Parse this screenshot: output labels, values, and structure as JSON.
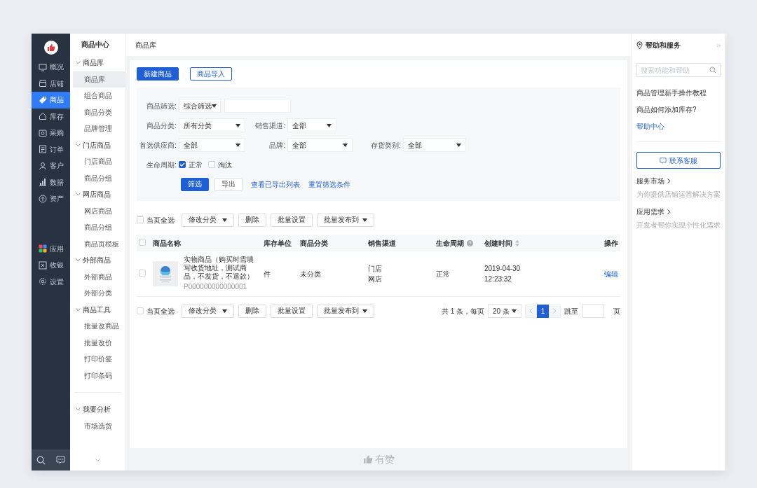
{
  "nav": {
    "main": [
      {
        "label": "概况",
        "kind": "monitor",
        "selected": false
      },
      {
        "label": "店铺",
        "kind": "shop",
        "selected": false
      },
      {
        "label": "商品",
        "kind": "tag",
        "selected": true
      },
      {
        "label": "库存",
        "kind": "house",
        "selected": false
      },
      {
        "label": "采购",
        "kind": "camera",
        "selected": false
      },
      {
        "label": "订单",
        "kind": "document",
        "selected": false
      },
      {
        "label": "客户",
        "kind": "person",
        "selected": false
      },
      {
        "label": "数据",
        "kind": "chart",
        "selected": false
      },
      {
        "label": "资产",
        "kind": "coin",
        "selected": false
      }
    ],
    "extra": [
      {
        "label": "应用",
        "kind": "apps",
        "selected": false
      },
      {
        "label": "收银",
        "kind": "cashier",
        "selected": false
      },
      {
        "label": "设置",
        "kind": "gear",
        "selected": false
      }
    ]
  },
  "submenu": {
    "title": "商品中心",
    "groups": [
      {
        "label": "商品库",
        "expanded": true,
        "children": [
          {
            "label": "商品库",
            "selected": true
          },
          {
            "label": "组合商品",
            "selected": false
          },
          {
            "label": "商品分类",
            "selected": false
          },
          {
            "label": "品牌管理",
            "selected": false
          }
        ]
      },
      {
        "label": "门店商品",
        "expanded": true,
        "children": [
          {
            "label": "门店商品",
            "selected": false
          },
          {
            "label": "商品分组",
            "selected": false
          }
        ]
      },
      {
        "label": "网店商品",
        "expanded": true,
        "children": [
          {
            "label": "网店商品",
            "selected": false
          },
          {
            "label": "商品分组",
            "selected": false
          },
          {
            "label": "商品页模板",
            "selected": false
          }
        ]
      },
      {
        "label": "外部商品",
        "expanded": true,
        "children": [
          {
            "label": "外部商品",
            "selected": false
          },
          {
            "label": "外部分类",
            "selected": false
          }
        ]
      },
      {
        "label": "商品工具",
        "expanded": true,
        "children": [
          {
            "label": "批量改商品",
            "selected": false
          },
          {
            "label": "批量改价",
            "selected": false
          },
          {
            "label": "打印价签",
            "selected": false
          },
          {
            "label": "打印条码",
            "selected": false
          }
        ]
      }
    ],
    "extra_groups": [
      {
        "label": "我要分析",
        "expanded": true,
        "children": [
          {
            "label": "市场选货",
            "selected": false
          }
        ]
      }
    ]
  },
  "breadcrumb": "商品库",
  "toolbar": [
    {
      "label": "新建商品",
      "kind": "primary"
    },
    {
      "label": "商品导入",
      "kind": "outline"
    }
  ],
  "filters": {
    "rows": [
      {
        "fields": [
          {
            "label": "商品筛选:",
            "kind": "select",
            "value": "综合筛选"
          },
          {
            "kind": "input"
          }
        ]
      },
      {
        "fields": [
          {
            "label": "商品分类:",
            "kind": "select",
            "value": "所有分类"
          },
          {
            "label": "销售渠道:",
            "kind": "select",
            "value": "全部"
          }
        ]
      },
      {
        "fields": [
          {
            "label": "首选供应商:",
            "kind": "select",
            "value": "全部"
          },
          {
            "label": "品牌:",
            "kind": "select",
            "value": "全部"
          },
          {
            "label": "存货类别:",
            "kind": "select",
            "value": "全部"
          }
        ]
      }
    ],
    "lifecycle": {
      "label": "生命周期:",
      "options": [
        {
          "label": "正常",
          "checked": true
        },
        {
          "label": "淘汰",
          "checked": false
        }
      ]
    },
    "actions": [
      {
        "label": "筛选",
        "kind": "primary"
      },
      {
        "label": "导出",
        "kind": "default"
      },
      {
        "label": "查看已导出列表",
        "kind": "link"
      },
      {
        "label": "重置筛选条件",
        "kind": "link"
      }
    ]
  },
  "bulk_top": {
    "select_all": {
      "label": "当页全选",
      "checked": false
    },
    "actions": [
      {
        "label": "修改分类",
        "kind": "dropdown"
      },
      {
        "label": "删除",
        "kind": "button"
      },
      {
        "label": "批量设置",
        "kind": "button"
      },
      {
        "label": "批量发布到",
        "kind": "dropdown"
      }
    ]
  },
  "table": {
    "select_all_checked": false,
    "columns": [
      {
        "label": "商品名称"
      },
      {
        "label": "库存单位"
      },
      {
        "label": "商品分类"
      },
      {
        "label": "销售渠道"
      },
      {
        "label": "生命周期",
        "help": true
      },
      {
        "label": "创建时间",
        "sortable": true
      },
      {
        "label": "操作"
      }
    ],
    "rows": [
      {
        "checked": false,
        "name": "实物商品（购买时需填写收货地址，测试商品，不发货，不退款）",
        "code": "P000000000000001",
        "unit": "件",
        "category": "未分类",
        "channels": [
          "门店",
          "网店"
        ],
        "lifecycle": "正常",
        "created": [
          "2019-04-30",
          "12:23:32"
        ],
        "action": "编辑"
      }
    ]
  },
  "bulk_bottom": {
    "select_all": {
      "label": "当页全选",
      "checked": false
    },
    "actions": [
      {
        "label": "修改分类",
        "kind": "dropdown"
      },
      {
        "label": "删除",
        "kind": "button"
      },
      {
        "label": "批量设置",
        "kind": "button"
      },
      {
        "label": "批量发布到",
        "kind": "dropdown"
      }
    ]
  },
  "pagination": {
    "summary": "共 1 条，每页",
    "page_size": "20 条",
    "pages": [
      {
        "label": "1",
        "selected": true
      }
    ],
    "prev_disabled": true,
    "next_disabled": true,
    "jump_label": "跳至",
    "page_suffix": "页"
  },
  "footer": {
    "brand": "有赞"
  },
  "help": {
    "title": "帮助和服务",
    "collapse": "»",
    "search_placeholder": "搜索功能和帮助",
    "links": [
      {
        "label": "商品管理新手操作教程",
        "kind": "text"
      },
      {
        "label": "商品如何添加库存?",
        "kind": "text"
      },
      {
        "label": "帮助中心",
        "kind": "link"
      }
    ],
    "contact": "联系客服",
    "sections": [
      {
        "title": "服务市场",
        "desc": "为你提供店铺运营解决方案"
      },
      {
        "title": "应用需求",
        "desc": "开发者帮你实现个性化需求"
      }
    ]
  }
}
